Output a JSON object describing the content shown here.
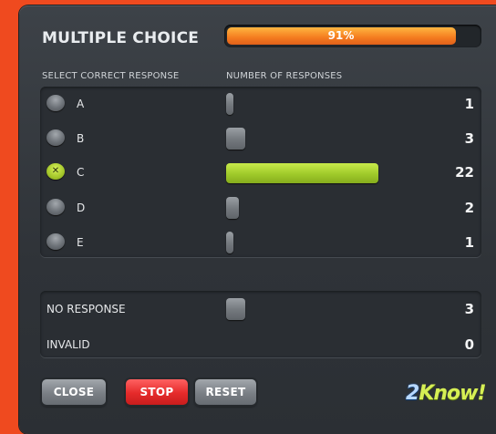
{
  "title": "MULTIPLE CHOICE",
  "percent": {
    "label": "91%",
    "value": 0.91
  },
  "headers": {
    "select": "SELECT CORRECT RESPONSE",
    "responses": "NUMBER OF RESPONSES"
  },
  "options": [
    {
      "letter": "A",
      "count": "1",
      "selected": false
    },
    {
      "letter": "B",
      "count": "3",
      "selected": false
    },
    {
      "letter": "C",
      "count": "22",
      "selected": true
    },
    {
      "letter": "D",
      "count": "2",
      "selected": false
    },
    {
      "letter": "E",
      "count": "1",
      "selected": false
    }
  ],
  "no_response": {
    "label": "NO RESPONSE",
    "count": "3"
  },
  "invalid": {
    "label": "INVALID",
    "count": "0"
  },
  "buttons": {
    "close": "CLOSE",
    "stop": "STOP",
    "reset": "RESET"
  },
  "logo": {
    "part1": "2",
    "part2": "Know!"
  },
  "colors": {
    "accent_orange": "#f47b1f",
    "correct_green": "#9fca2a",
    "stop_red": "#e52a2a",
    "background": "#ef4a1f"
  }
}
